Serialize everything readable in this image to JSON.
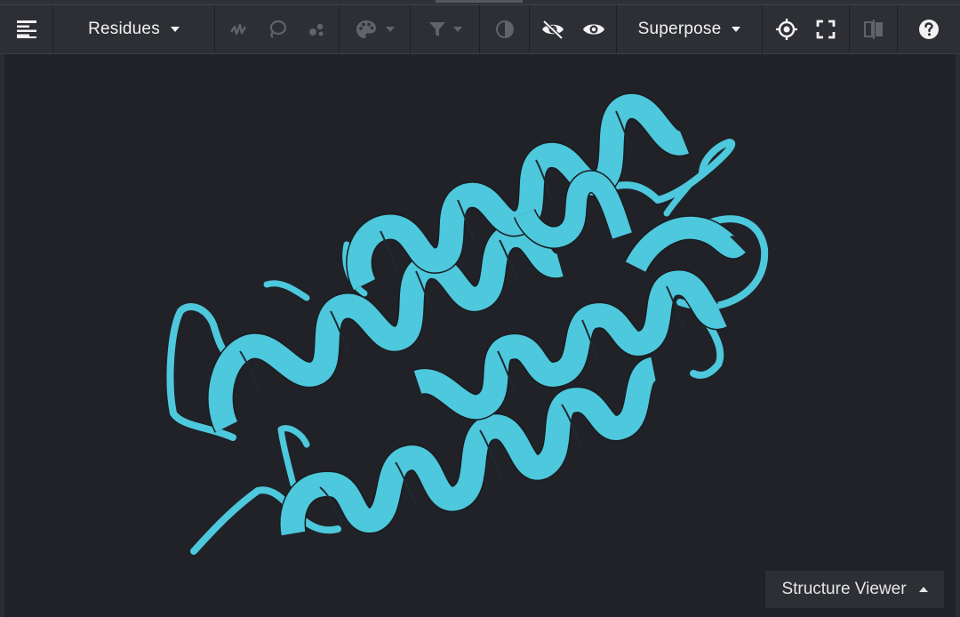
{
  "toolbar": {
    "menu_icon": "lines-icon",
    "residues_label": "Residues",
    "superpose_label": "Superpose",
    "icons": {
      "helix": "helix-icon",
      "lasso": "lasso-icon",
      "atoms": "atoms-icon",
      "palette": "palette-icon",
      "filter": "filter-icon",
      "contrast": "contrast-icon",
      "hide": "eye-off-icon",
      "show": "eye-icon",
      "center": "crosshair-icon",
      "fullscreen": "fullscreen-icon",
      "split": "split-view-icon",
      "help": "help-icon"
    }
  },
  "viewer": {
    "ribbon_color": "#4dc8dd",
    "background": "#202228"
  },
  "panel": {
    "label": "Structure Viewer"
  }
}
